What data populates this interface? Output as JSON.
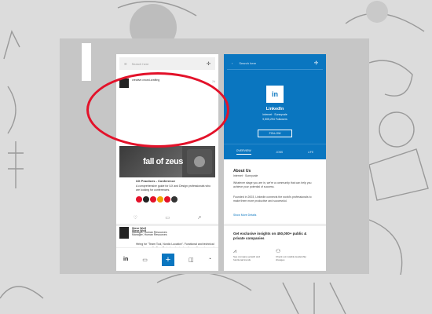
{
  "phone1": {
    "search_placeholder": "Search here",
    "post1": {
      "source": "creative.crowd-crafting",
      "time": "2d",
      "image_title": "fall of zeus",
      "headline": "UX Practices - Conference",
      "body": "A comprehensive guide for UX and Design professionals who are looking for conferences."
    },
    "post2": {
      "author": "Steve Wolf",
      "role": "Manager, Human Resources",
      "body": "Hiring for \"Team Tool, Nordic Location\". Functional and technical experience with OpenText, develop instructions with custom and standard patterns."
    },
    "post3": {
      "author": "Steve Wolf",
      "role": "Manager, Human Resources"
    },
    "tabbar": {
      "home": "in",
      "messages": "▭",
      "add": "+",
      "jobs": "◫",
      "alerts": "◔"
    }
  },
  "phone2": {
    "search_placeholder": "Search here",
    "logo_text": "in",
    "company_name": "LinkedIn",
    "company_meta": "Internet · Sunnyvale",
    "followers": "9,505,294 Followers",
    "follow_label": "FOLLOW",
    "tabs": [
      "OVERVIEW",
      "JOBS",
      "LIFE"
    ],
    "about_title": "About Us",
    "about_sub": "Internet · Sunnyvale",
    "about_p1": "Whatever stage you are in, we're a community that can help you achieve your potential of success.",
    "about_p2": "Founded in 2003, LinkedIn connects the world's professionals to make them more productive and successful.",
    "show_more": "Show More Details",
    "promo": "Get exclusive insights on 450,000+ public & private companies",
    "feature1": "See company growth and functional trends",
    "feature2": "Check out notable leadership changes"
  },
  "colors": {
    "linkedin_blue": "#0a76c0",
    "annotation_red": "#e3122a"
  }
}
